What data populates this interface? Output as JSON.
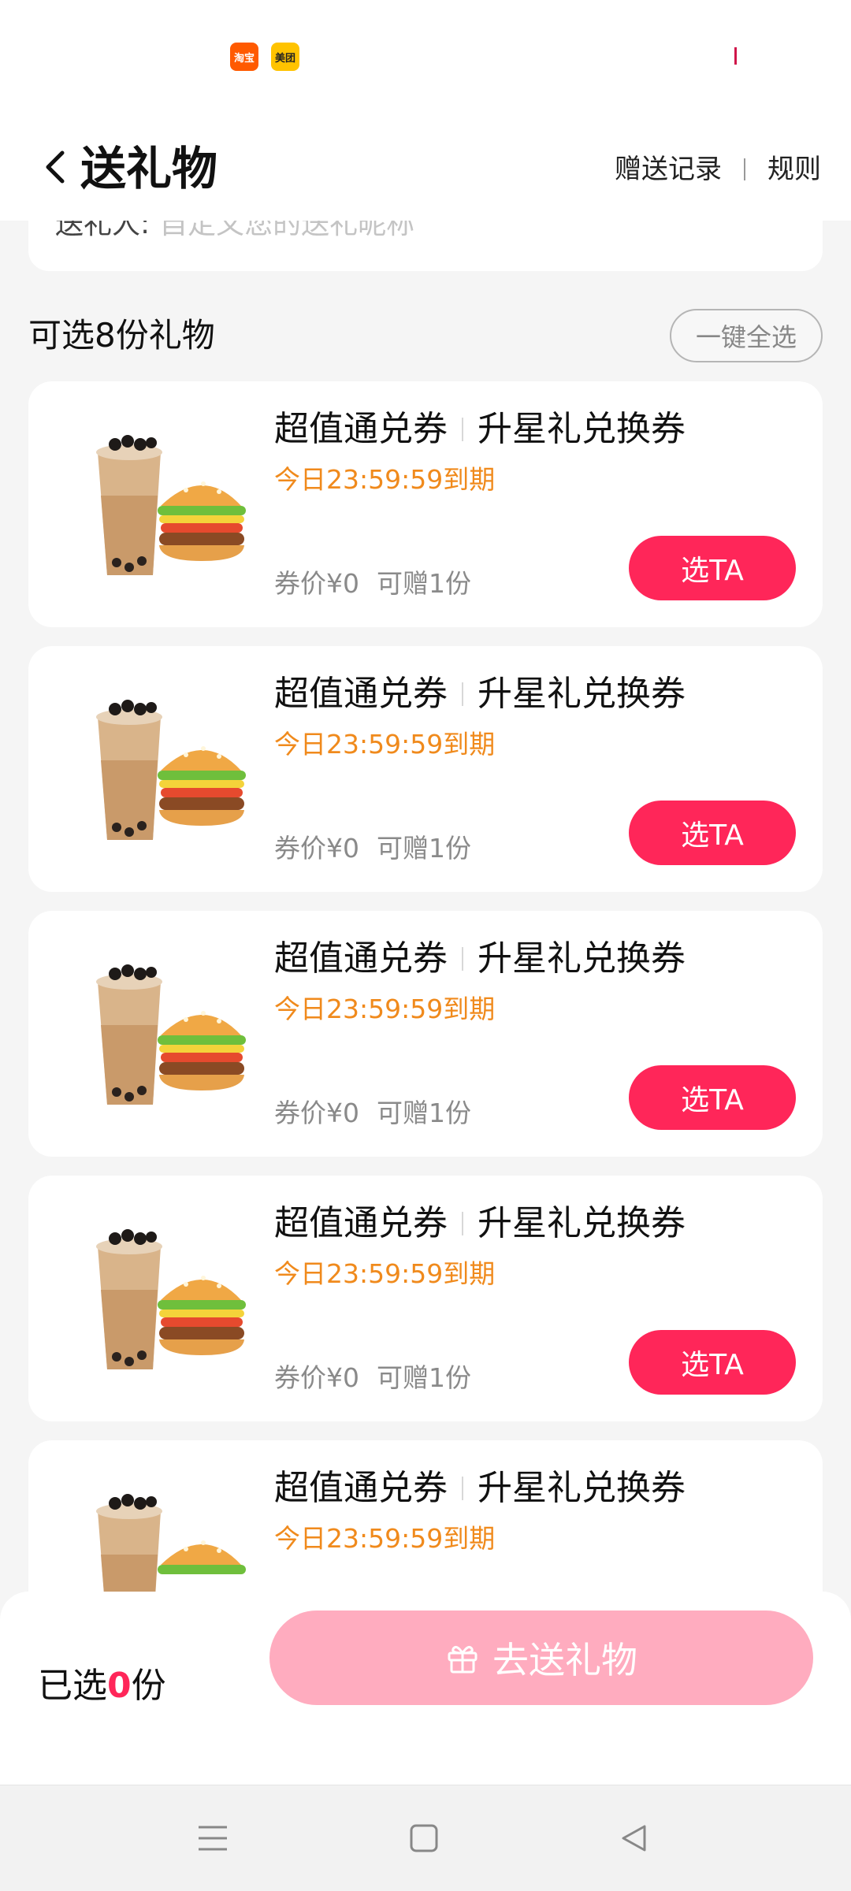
{
  "status_bar": {
    "app_badges": [
      "淘宝",
      "美团"
    ]
  },
  "header": {
    "title": "送礼物",
    "links": [
      "赠送记录",
      "规则"
    ]
  },
  "sender": {
    "label": "送礼人:",
    "placeholder": "自定义您的送礼昵称"
  },
  "selectable": {
    "title": "可选8份礼物",
    "select_all": "一键全选"
  },
  "gifts": [
    {
      "name_a": "超值通兑券",
      "name_b": "升星礼兑换券",
      "expire": "今日23:59:59到期",
      "price": "券价¥0",
      "quota": "可赠1份",
      "button": "选TA"
    },
    {
      "name_a": "超值通兑券",
      "name_b": "升星礼兑换券",
      "expire": "今日23:59:59到期",
      "price": "券价¥0",
      "quota": "可赠1份",
      "button": "选TA"
    },
    {
      "name_a": "超值通兑券",
      "name_b": "升星礼兑换券",
      "expire": "今日23:59:59到期",
      "price": "券价¥0",
      "quota": "可赠1份",
      "button": "选TA"
    },
    {
      "name_a": "超值通兑券",
      "name_b": "升星礼兑换券",
      "expire": "今日23:59:59到期",
      "price": "券价¥0",
      "quota": "可赠1份",
      "button": "选TA"
    },
    {
      "name_a": "超值通兑券",
      "name_b": "升星礼兑换券",
      "expire": "今日23:59:59到期",
      "price": "",
      "quota": "",
      "button": ""
    }
  ],
  "bottom": {
    "selected_prefix": "已选",
    "selected_count": "0",
    "selected_suffix": "份",
    "send_label": "去送礼物"
  },
  "icons": {
    "back": "chevron-left-icon",
    "gift": "gift-icon",
    "nav": [
      "menu-icon",
      "home-square-icon",
      "back-triangle-icon"
    ]
  },
  "colors": {
    "accent": "#ff2659",
    "accent_disabled": "#ffacbf",
    "expire_text": "#f08a1c"
  }
}
